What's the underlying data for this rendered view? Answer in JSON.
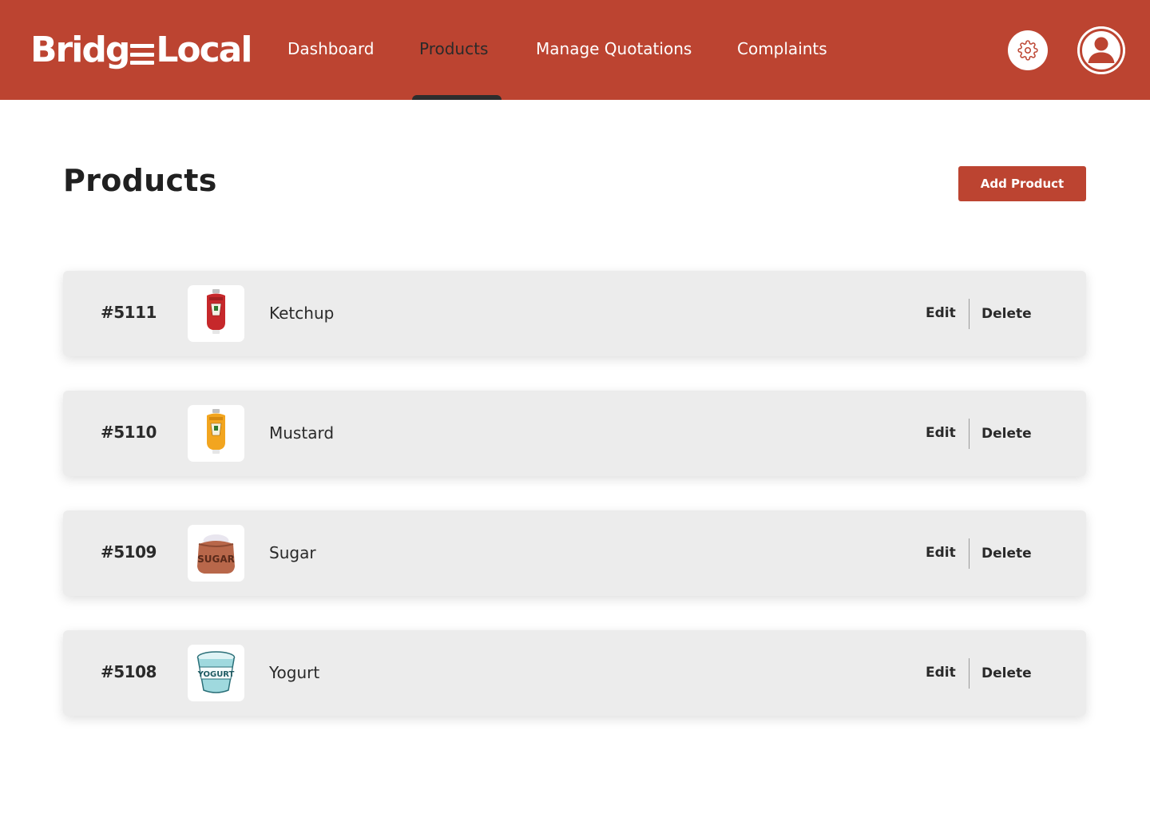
{
  "brand": {
    "logo_left": "Bridg",
    "logo_right": "Local",
    "color": "#bc4431"
  },
  "nav": {
    "items": [
      {
        "label": "Dashboard",
        "active": false
      },
      {
        "label": "Products",
        "active": true
      },
      {
        "label": "Manage Quotations",
        "active": false
      },
      {
        "label": "Complaints",
        "active": false
      }
    ]
  },
  "header_icons": {
    "settings": "gear-icon",
    "profile": "user-icon"
  },
  "main": {
    "title": "Products",
    "add_button_label": "Add Product"
  },
  "products": [
    {
      "id": "#5111",
      "name": "Ketchup",
      "image": "ketchup-bottle-icon",
      "edit_label": "Edit",
      "delete_label": "Delete"
    },
    {
      "id": "#5110",
      "name": "Mustard",
      "image": "mustard-bottle-icon",
      "edit_label": "Edit",
      "delete_label": "Delete"
    },
    {
      "id": "#5109",
      "name": "Sugar",
      "image": "sugar-sack-icon",
      "sack_label": "SUGAR",
      "edit_label": "Edit",
      "delete_label": "Delete"
    },
    {
      "id": "#5108",
      "name": "Yogurt",
      "image": "yogurt-cup-icon",
      "cup_label": "YOGURT",
      "edit_label": "Edit",
      "delete_label": "Delete"
    }
  ]
}
